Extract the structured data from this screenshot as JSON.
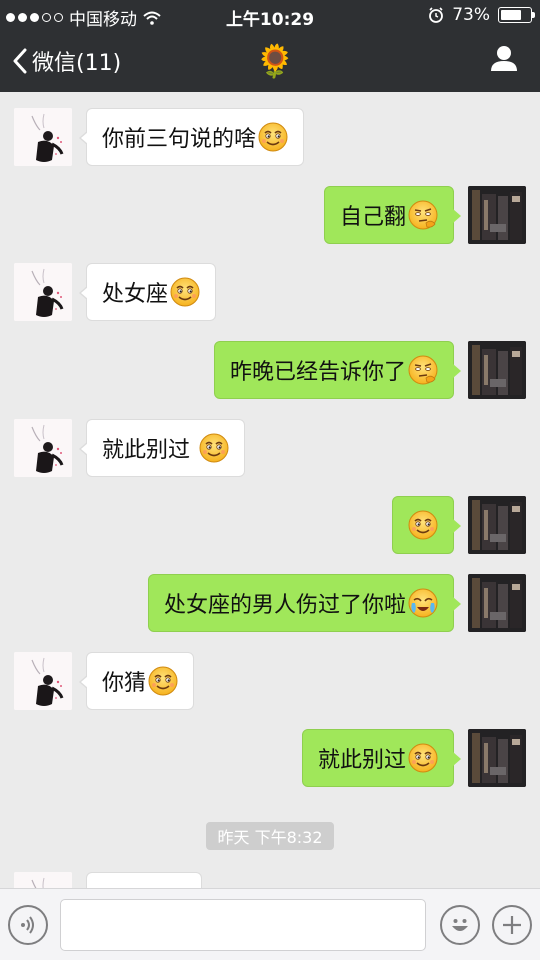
{
  "status": {
    "carrier": "中国移动",
    "time": "上午10:29",
    "battery": "73%",
    "battery_level": 0.73
  },
  "nav": {
    "back_label": "微信(11)",
    "title_icon": "🌻"
  },
  "messages": [
    {
      "from": "her",
      "text": "你前三句说的啥",
      "emoji": "smirk-emoji"
    },
    {
      "from": "me",
      "text": "自己翻",
      "emoji": "thinking-emoji"
    },
    {
      "from": "her",
      "text": "处女座",
      "emoji": "smirk-emoji"
    },
    {
      "from": "me",
      "text": "昨晚已经告诉你了",
      "emoji": "thinking-emoji"
    },
    {
      "from": "her",
      "text": "就此别过 ",
      "emoji": "smirk-emoji"
    },
    {
      "from": "me",
      "text": "",
      "emoji": "smirk-emoji"
    },
    {
      "from": "me",
      "text": "处女座的男人伤过了你啦",
      "emoji": "crying-emoji"
    },
    {
      "from": "her",
      "text": "你猜",
      "emoji": "smirk-emoji"
    },
    {
      "from": "me",
      "text": "就此别过",
      "emoji": "smirk-emoji"
    }
  ],
  "timestamp": "昨天 下午8:32",
  "input": {
    "value": "",
    "placeholder": ""
  },
  "colors": {
    "top_bar": "#2e3033",
    "chat_bg": "#ebebeb",
    "my_bubble": "#a0e75a",
    "her_bubble": "#ffffff"
  }
}
